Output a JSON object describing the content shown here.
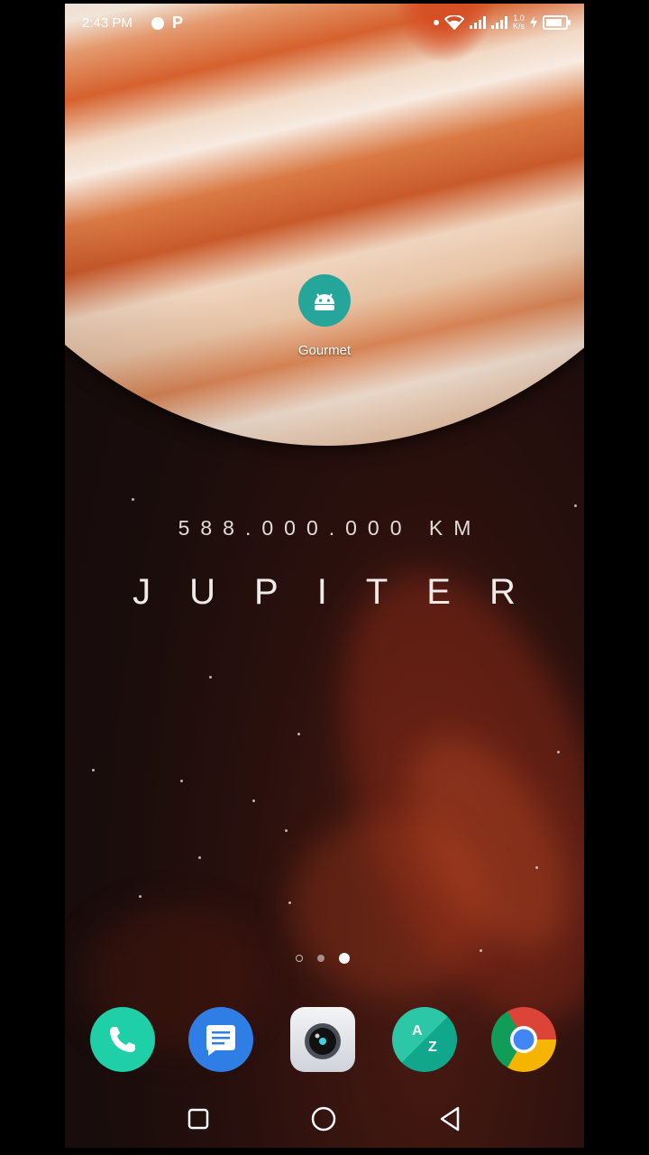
{
  "status_bar": {
    "time": "2:43 PM",
    "p_icon_label": "P",
    "net_speed_top": "1.0",
    "net_speed_bottom": "K/s",
    "icons": [
      "notification-dot",
      "p-app-icon",
      "small-dot",
      "wifi-icon",
      "signal-icon",
      "signal-icon",
      "net-speed",
      "charging-icon",
      "battery-icon"
    ]
  },
  "home": {
    "apps": [
      {
        "label": "Gourmet",
        "icon": "android-icon",
        "color": "#26a69a"
      }
    ]
  },
  "wallpaper": {
    "distance": "588.000.000 KM",
    "planet_name": "JUPITER"
  },
  "page_indicator": {
    "pages": 3,
    "current": 3
  },
  "dock": {
    "apps": [
      {
        "name": "Phone",
        "icon": "phone-icon",
        "color": "#1ecfa8"
      },
      {
        "name": "Messages",
        "icon": "message-icon",
        "color": "#2f7ee6"
      },
      {
        "name": "Camera",
        "icon": "camera-icon",
        "color": "#e7e9ee"
      },
      {
        "name": "A-Z",
        "icon": "az-icon",
        "color": "#1bb79a",
        "text_top": "A",
        "text_bottom": "Z"
      },
      {
        "name": "Chrome",
        "icon": "chrome-icon",
        "color": "#db4437"
      }
    ]
  },
  "nav_bar": {
    "buttons": [
      "recents-icon",
      "home-icon",
      "back-icon"
    ]
  }
}
